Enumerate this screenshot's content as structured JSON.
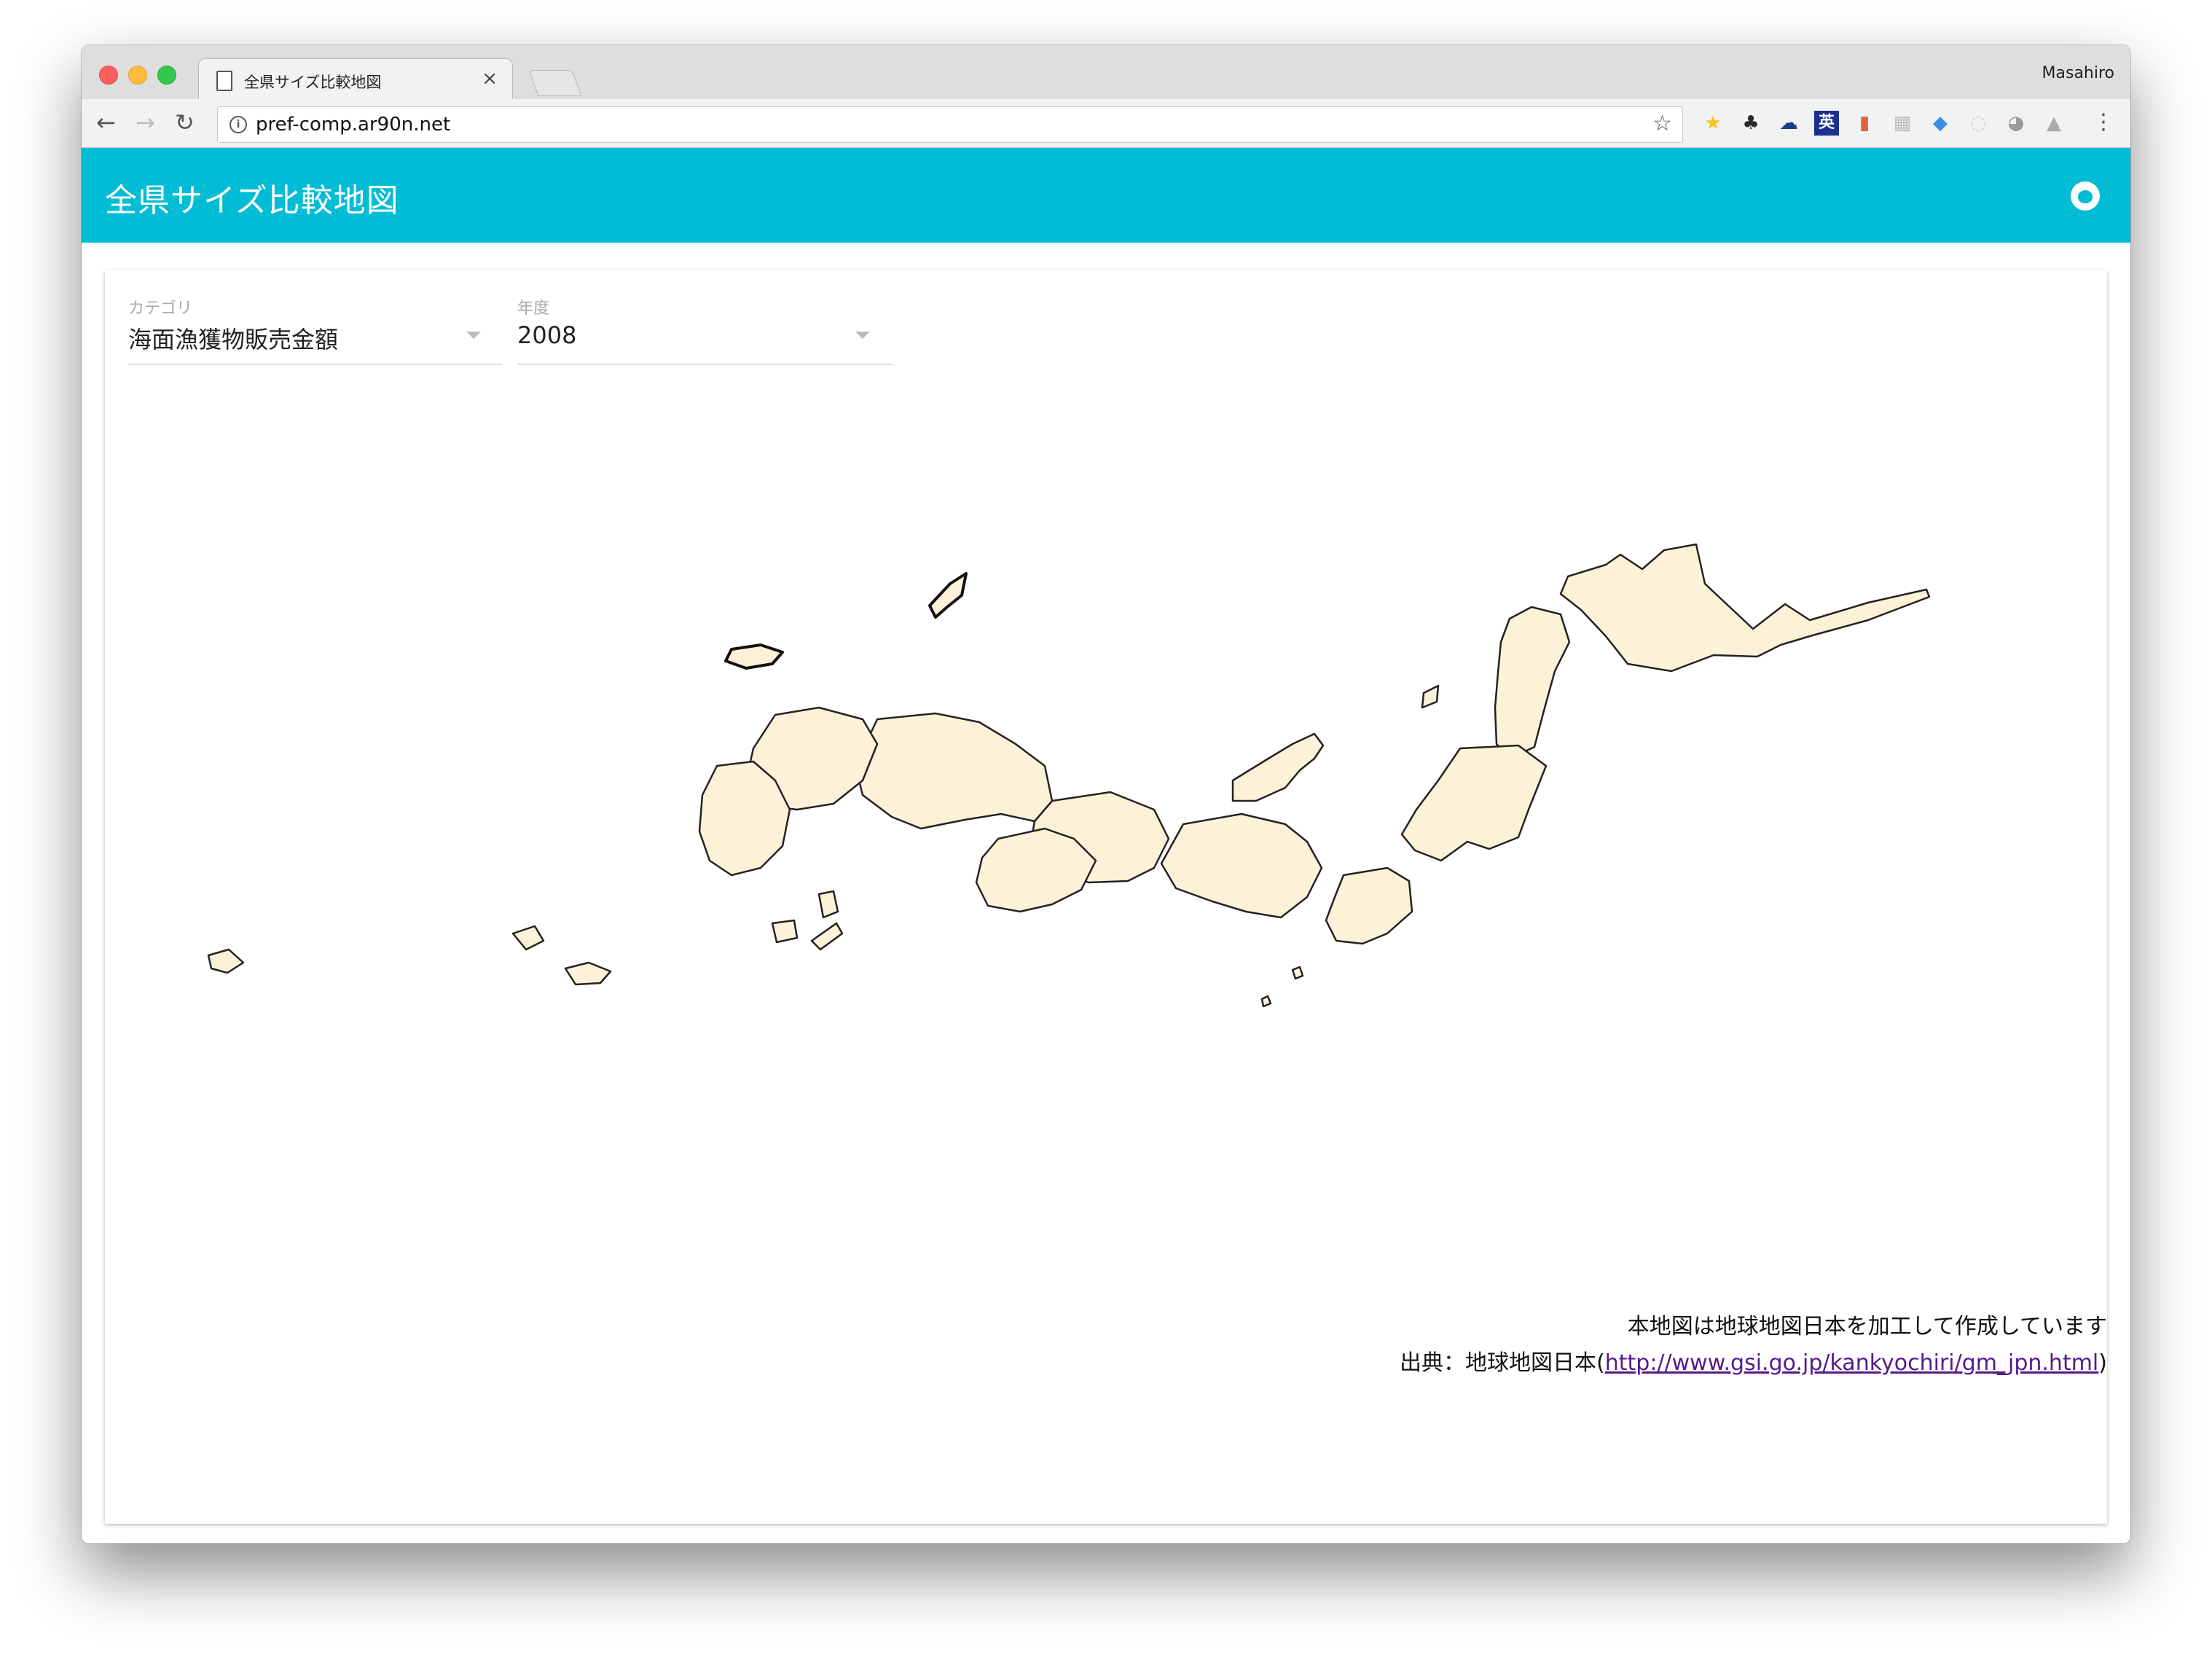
{
  "browser": {
    "tab_title": "全県サイズ比較地図",
    "tab_close": "×",
    "user_name": "Masahiro",
    "url": "pref-comp.ar90n.net",
    "back": "←",
    "forward": "→",
    "reload": "↻",
    "bookmark_star": "☆",
    "menu": "⋮",
    "extensions": [
      {
        "name": "star-extension-icon",
        "glyph": "★",
        "color": "#f5c518"
      },
      {
        "name": "evernote-icon",
        "glyph": "♣",
        "color": "#2a2a2a"
      },
      {
        "name": "cloud-icon",
        "glyph": "☁",
        "color": "#1b3f8f"
      },
      {
        "name": "english-dictionary-icon",
        "glyph": "英",
        "color": "#ffffff",
        "bg": "#1b2f8f"
      },
      {
        "name": "book-icon",
        "glyph": "▮",
        "color": "#e06040"
      },
      {
        "name": "grid-icon",
        "glyph": "▦",
        "color": "#bbbbbb"
      },
      {
        "name": "pocket-icon",
        "glyph": "◆",
        "color": "#3a8ee6"
      },
      {
        "name": "circle-icon",
        "glyph": "◌",
        "color": "#cccccc"
      },
      {
        "name": "globe-icon",
        "glyph": "◕",
        "color": "#999999"
      },
      {
        "name": "drive-icon",
        "glyph": "▲",
        "color": "#aaaaaa"
      }
    ]
  },
  "app": {
    "title": "全県サイズ比較地図"
  },
  "filters": {
    "category": {
      "label": "カテゴリ",
      "value": "海面漁獲物販売金額"
    },
    "year": {
      "label": "年度",
      "value": "2008"
    }
  },
  "map": {
    "fill_color": "#fdf2d8",
    "stroke_color": "#222222"
  },
  "credits": {
    "line1": "本地図は地球地図日本を加工して作成しています",
    "line2_prefix": "出典：地球地図日本(",
    "line2_link": "http://www.gsi.go.jp/kankyochiri/gm_jpn.html",
    "line2_suffix": ")"
  }
}
